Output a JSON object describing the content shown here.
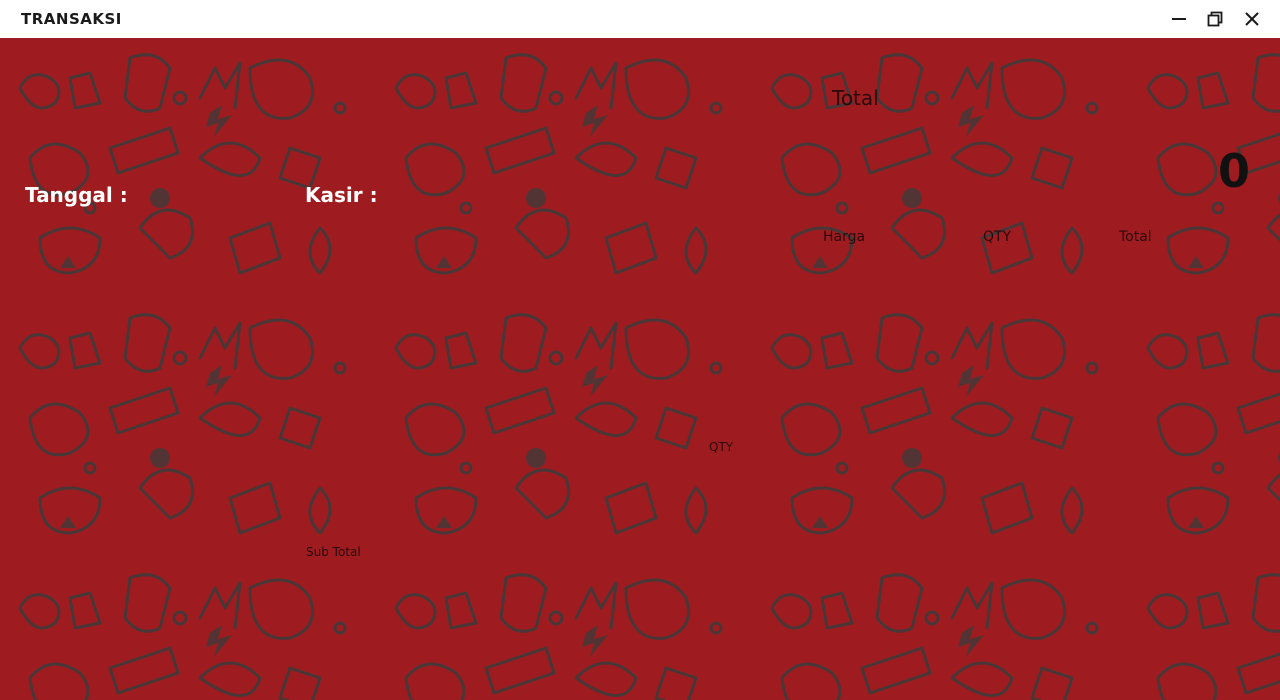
{
  "window": {
    "title": "TRANSAKSI",
    "controls": {
      "minimize": "minimize-icon",
      "maximize": "restore-icon",
      "close": "close-icon"
    }
  },
  "form": {
    "tanggal_label": "Tanggal :",
    "kasir_label": "Kasir :",
    "total_heading": "Total",
    "total_value": "0",
    "columns": {
      "harga": "Harga",
      "qty": "QTY",
      "total": "Total"
    },
    "qty_input_label": "QTY",
    "subtotal_label": "Sub Total"
  },
  "colors": {
    "background": "#9e1c20",
    "doodle": "#3a3a3a",
    "titlebar": "#ffffff"
  }
}
